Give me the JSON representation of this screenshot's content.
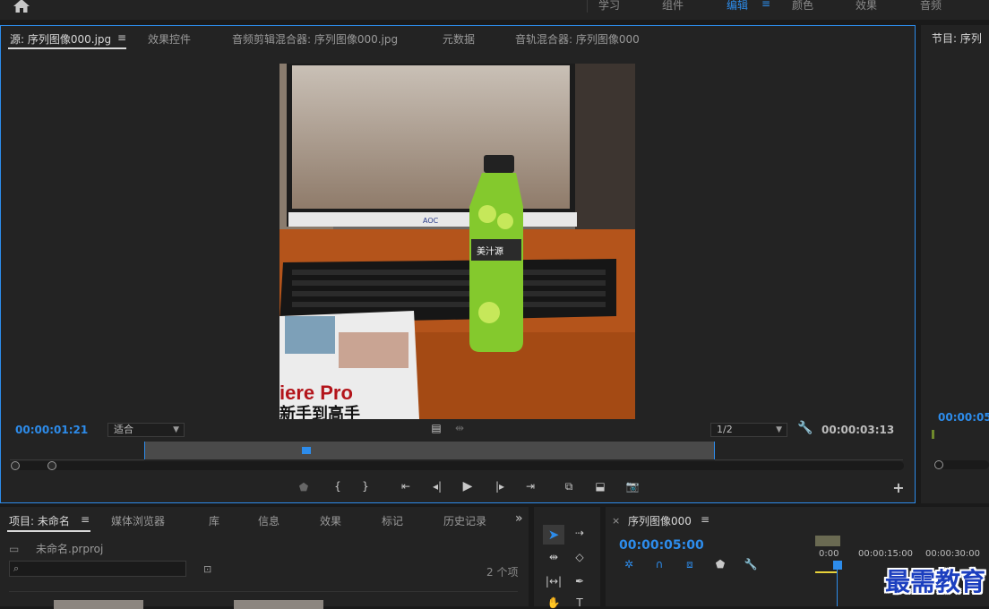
{
  "workspaces": [
    {
      "label": "学习",
      "active": false
    },
    {
      "label": "组件",
      "active": false
    },
    {
      "label": "编辑",
      "active": true
    },
    {
      "label": "颜色",
      "active": false
    },
    {
      "label": "效果",
      "active": false
    },
    {
      "label": "音频",
      "active": false
    }
  ],
  "source_panel": {
    "tabs": [
      "源: 序列图像000.jpg",
      "效果控件",
      "音频剪辑混合器: 序列图像000.jpg",
      "元数据",
      "音轨混合器: 序列图像000"
    ],
    "timecode_in": "00:00:01:21",
    "fit": "适合",
    "resolution": "1/2",
    "timecode_out": "00:00:03:13",
    "viewer_text": {
      "book": "iere Pro",
      "book_sub": "新手到高手",
      "brand": "美汁源",
      "monitor_brand": "AOC"
    }
  },
  "program_panel": {
    "title": "节目: 序列",
    "timecode": "00:00:05"
  },
  "project_panel": {
    "tabs": [
      "项目: 未命名",
      "媒体浏览器",
      "库",
      "信息",
      "效果",
      "标记",
      "历史记录"
    ],
    "file": "未命名.prproj",
    "count": "2 个项",
    "search_placeholder": ""
  },
  "timeline_panel": {
    "title": "序列图像000",
    "timecode": "00:00:05:00",
    "ruler": [
      "0:00",
      "00:00:15:00",
      "00:00:30:00"
    ]
  },
  "watermark": "最需教育",
  "colors": {
    "accent": "#2d8ceb",
    "panel": "#232323",
    "background": "#1a1a1a"
  }
}
